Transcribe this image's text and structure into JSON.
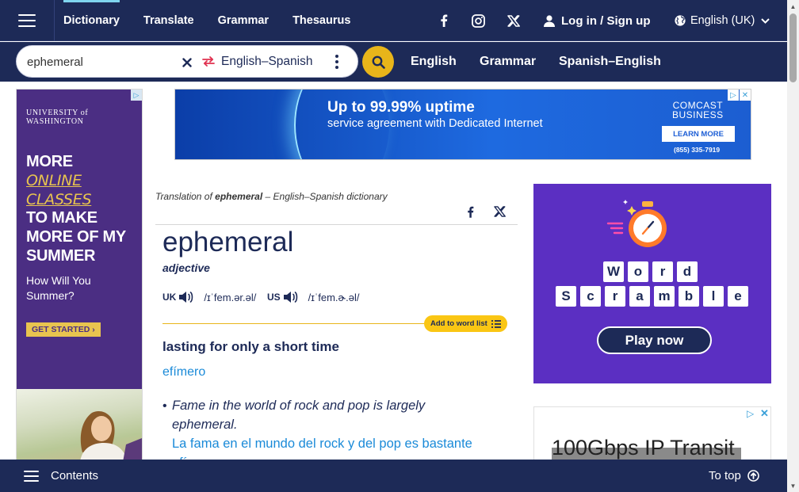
{
  "nav": {
    "links": [
      "Dictionary",
      "Translate",
      "Grammar",
      "Thesaurus"
    ],
    "active": "Dictionary",
    "social": [
      "facebook-icon",
      "instagram-icon",
      "x-icon"
    ],
    "login": "Log in / Sign up",
    "language": "English (UK)"
  },
  "search": {
    "value": "ephemeral",
    "dictionary": "English–Spanish",
    "quick_links": [
      "English",
      "Grammar",
      "Spanish–English"
    ]
  },
  "ads": {
    "left": {
      "brand": "UNIVERSITY of WASHINGTON",
      "line1": "MORE",
      "line2": "ONLINE",
      "line3": "CLASSES",
      "line4": "TO MAKE",
      "line5": "MORE OF MY",
      "line6": "SUMMER",
      "sub": "How Will You Summer?",
      "cta": "GET STARTED ›"
    },
    "top": {
      "headline": "Up to 99.99% uptime",
      "subline": "service agreement with Dedicated Internet",
      "brand_line1": "COMCAST",
      "brand_line2": "BUSINESS",
      "cta": "LEARN MORE",
      "phone": "(855) 335-7919"
    },
    "game": {
      "row1": [
        "W",
        "o",
        "r",
        "d"
      ],
      "row2": [
        "S",
        "c",
        "r",
        "a",
        "m",
        "b",
        "l",
        "e"
      ],
      "cta": "Play now"
    },
    "ip": {
      "text": "100Gbps IP Transit"
    }
  },
  "entry": {
    "crumb_prefix": "Translation of ",
    "crumb_word": "ephemeral",
    "crumb_suffix": " – English–Spanish dictionary",
    "headword": "ephemeral",
    "pos": "adjective",
    "uk_label": "UK",
    "uk_ipa": "/ɪˈfem.ər.əl/",
    "us_label": "US",
    "us_ipa": "/ɪˈfem.ɚ.əl/",
    "add_to_list": "Add to word list",
    "definition": "lasting for only a short time",
    "translation": "efímero",
    "example": "Fame in the world of rock and pop is largely ephemeral.",
    "example_translation": "La fama en el mundo del rock y del pop es bastante efímera."
  },
  "bottom": {
    "contents": "Contents",
    "to_top": "To top"
  },
  "colors": {
    "navy": "#1d2a57",
    "gold": "#e8b51a",
    "link_blue": "#1a8ad8",
    "uw_purple": "#4b2e83",
    "game_purple": "#5b2fc2"
  }
}
